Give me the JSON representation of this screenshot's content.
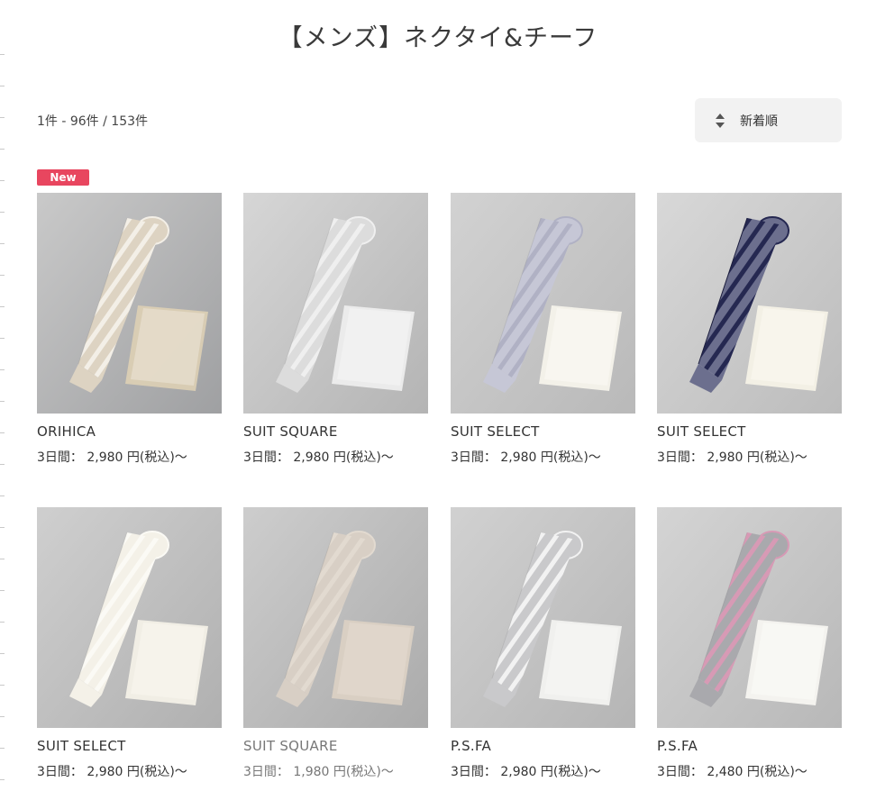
{
  "page": {
    "title": "【メンズ】ネクタイ&チーフ",
    "result_count": "1件 - 96件 / 153件"
  },
  "sort": {
    "label": "新着順",
    "icon": "sort-updown-icon"
  },
  "badge": {
    "new_label": "New",
    "color": "#e8465f"
  },
  "products": [
    {
      "brand": "ORIHICA",
      "price": "3日間： 2,980 円(税込)～",
      "tie": "beige-stripe",
      "muted": false
    },
    {
      "brand": "SUIT SQUARE",
      "price": "3日間： 2,980 円(税込)～",
      "tie": "silver-paisley",
      "muted": false
    },
    {
      "brand": "SUIT SELECT",
      "price": "3日間： 2,980 円(税込)～",
      "tie": "lilac-stripe",
      "muted": false
    },
    {
      "brand": "SUIT SELECT",
      "price": "3日間： 2,980 円(税込)～",
      "tie": "navy-stripe",
      "muted": false
    },
    {
      "brand": "SUIT SELECT",
      "price": "3日間： 2,980 円(税込)～",
      "tie": "white-stripe",
      "muted": false
    },
    {
      "brand": "SUIT SQUARE",
      "price": "3日間： 1,980 円(税込)～",
      "tie": "champagne-solid",
      "muted": true
    },
    {
      "brand": "P.S.FA",
      "price": "3日間： 2,980 円(税込)～",
      "tie": "silver-dots",
      "muted": false
    },
    {
      "brand": "P.S.FA",
      "price": "3日間： 2,480 円(税込)～",
      "tie": "pink-paisley",
      "muted": false
    }
  ]
}
